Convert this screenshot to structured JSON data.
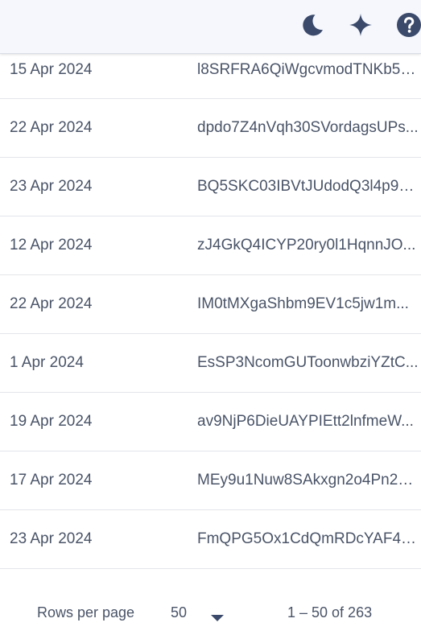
{
  "toolbar": {
    "theme_icon": "moon-icon",
    "sparkle_icon": "sparkle-icon",
    "help_icon": "help-icon",
    "icon_color": "#3b4a6b"
  },
  "rows": [
    {
      "date": "15 Apr 2024",
      "token": "l8SRFRA6QiWgcvmodTNKb5e..."
    },
    {
      "date": "22 Apr 2024",
      "token": "dpdo7Z4nVqh30SVordagsUPs..."
    },
    {
      "date": "23 Apr 2024",
      "token": "BQ5SKC03IBVtJUdodQ3l4p9J..."
    },
    {
      "date": "12 Apr 2024",
      "token": "zJ4GkQ4ICYP20ry0l1HqnnJO..."
    },
    {
      "date": "22 Apr 2024",
      "token": "IM0tMXgaShbm9EV1c5jw1m..."
    },
    {
      "date": "1 Apr 2024",
      "token": "EsSP3NcomGUToonwbziYZtC..."
    },
    {
      "date": "19 Apr 2024",
      "token": "av9NjP6DieUAYPIEtt2lnfmeW..."
    },
    {
      "date": "17 Apr 2024",
      "token": "MEy9u1Nuw8SAkxgn2o4Pn2n..."
    },
    {
      "date": "23 Apr 2024",
      "token": "FmQPG5Ox1CdQmRDcYAF41..."
    }
  ],
  "pagination": {
    "rows_per_page_label": "Rows per page",
    "rows_per_page_value": "50",
    "range_text": "1 – 50 of 263"
  }
}
